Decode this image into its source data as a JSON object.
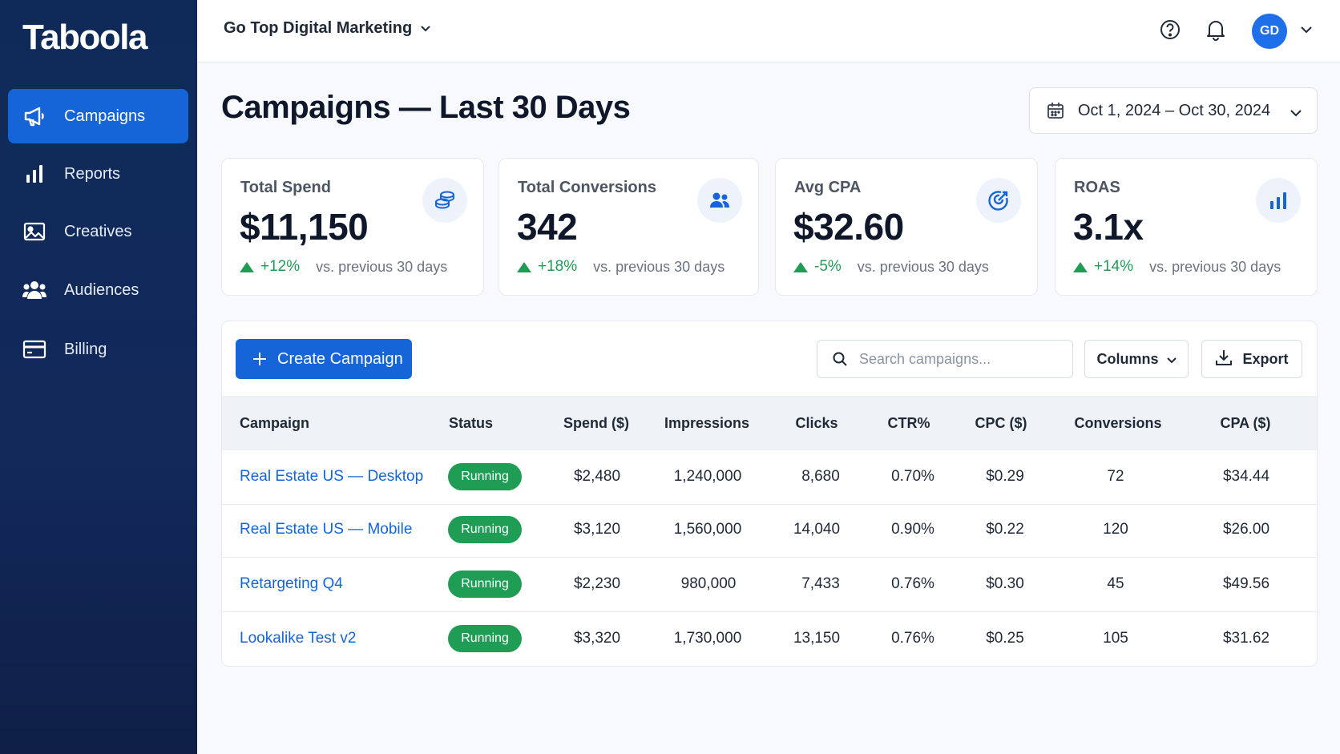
{
  "app": {
    "logo": "Taboola"
  },
  "sidebar": {
    "items": [
      {
        "label": "Campaigns",
        "icon": "megaphone-icon",
        "active": true
      },
      {
        "label": "Reports",
        "icon": "bar-chart-icon",
        "active": false
      },
      {
        "label": "Creatives",
        "icon": "image-icon",
        "active": false
      },
      {
        "label": "Audiences",
        "icon": "users-icon",
        "active": false
      },
      {
        "label": "Billing",
        "icon": "credit-card-icon",
        "active": false
      }
    ]
  },
  "header": {
    "account": "Go Top Digital Marketing",
    "avatar_initials": "GD"
  },
  "page": {
    "title": "Campaigns — Last 30 Days",
    "date_range": "Oct 1, 2024 – Oct 30, 2024"
  },
  "kpis": [
    {
      "label": "Total Spend",
      "value": "$11,150",
      "delta": "+12%",
      "comparison": "vs. previous 30 days",
      "icon": "coins-icon"
    },
    {
      "label": "Total Conversions",
      "value": "342",
      "delta": "+18%",
      "comparison": "vs. previous 30 days",
      "icon": "users-icon"
    },
    {
      "label": "Avg CPA",
      "value": "$32.60",
      "delta": "-5%",
      "comparison": "vs. previous 30 days",
      "icon": "target-icon"
    },
    {
      "label": "ROAS",
      "value": "3.1x",
      "delta": "+14%",
      "comparison": "vs. previous 30 days",
      "icon": "bar-chart-icon"
    }
  ],
  "toolbar": {
    "create_label": "Create Campaign",
    "search_placeholder": "Search campaigns...",
    "columns_label": "Columns",
    "export_label": "Export"
  },
  "table": {
    "columns": [
      "Campaign",
      "Status",
      "Spend ($)",
      "Impressions",
      "Clicks",
      "CTR%",
      "CPC ($)",
      "Conversions",
      "CPA ($)"
    ],
    "rows": [
      {
        "campaign": "Real Estate US — Desktop",
        "status": "Running",
        "spend": "$2,480",
        "impressions": "1,240,000",
        "clicks": "8,680",
        "ctr": "0.70%",
        "cpc": "$0.29",
        "conversions": "72",
        "cpa": "$34.44"
      },
      {
        "campaign": "Real Estate US — Mobile",
        "status": "Running",
        "spend": "$3,120",
        "impressions": "1,560,000",
        "clicks": "14,040",
        "ctr": "0.90%",
        "cpc": "$0.22",
        "conversions": "120",
        "cpa": "$26.00"
      },
      {
        "campaign": "Retargeting Q4",
        "status": "Running",
        "spend": "$2,230",
        "impressions": "980,000",
        "clicks": "7,433",
        "ctr": "0.76%",
        "cpc": "$0.30",
        "conversions": "45",
        "cpa": "$49.56"
      },
      {
        "campaign": "Lookalike Test v2",
        "status": "Running",
        "spend": "$3,320",
        "impressions": "1,730,000",
        "clicks": "13,150",
        "ctr": "0.76%",
        "cpc": "$0.25",
        "conversions": "105",
        "cpa": "$31.62"
      }
    ]
  },
  "colors": {
    "sidebar": "#0f2a59",
    "accent": "#1565d8",
    "success": "#1f9d55"
  }
}
